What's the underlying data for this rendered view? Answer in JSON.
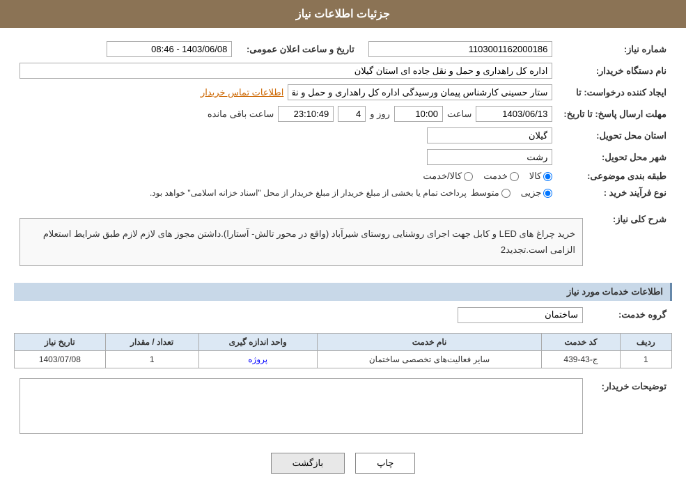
{
  "header": {
    "title": "جزئیات اطلاعات نیاز"
  },
  "fields": {
    "need_number_label": "شماره نیاز:",
    "need_number_value": "1103001162000186",
    "announce_date_label": "تاریخ و ساعت اعلان عمومی:",
    "announce_date_value": "1403/06/08 - 08:46",
    "buyer_name_label": "نام دستگاه خریدار:",
    "buyer_name_value": "اداره کل راهداری و حمل و نقل جاده ای استان گیلان",
    "creator_label": "ایجاد کننده درخواست: تا",
    "creator_value": "ستار حسینی کارشناس پیمان ورسیدگی اداره کل راهداری و حمل و نقل جاده اد",
    "creator_link": "اطلاعات تماس خریدار",
    "deadline_label": "مهلت ارسال پاسخ: تا تاریخ:",
    "deadline_date": "1403/06/13",
    "deadline_time_label": "ساعت",
    "deadline_time": "10:00",
    "deadline_days_label": "روز و",
    "deadline_days": "4",
    "deadline_remaining_label": "ساعت باقی مانده",
    "deadline_remaining": "23:10:49",
    "province_label": "استان محل تحویل:",
    "province_value": "گیلان",
    "city_label": "شهر محل تحویل:",
    "city_value": "رشت",
    "category_label": "طبقه بندی موضوعی:",
    "category_radio1": "کالا",
    "category_radio2": "خدمت",
    "category_radio3": "کالا/خدمت",
    "process_label": "نوع فرآیند خرید :",
    "process_radio1": "جزیی",
    "process_radio2": "متوسط",
    "process_note": "پرداخت تمام یا بخشی از مبلغ خریدار از مبلغ خریدار از محل \"اسناد خزانه اسلامی\" خواهد بود.",
    "description_label": "شرح کلی نیاز:",
    "description_text": "خرید چراغ های  LED  و کابل جهت اجرای روشنایی روستای شیرآباد (واقع در محور تالش- آستارا).داشتن مجوز های لازم لازم طبق شرایط استعلام الزامی است.تجدید2",
    "services_section": "اطلاعات خدمات مورد نیاز",
    "service_group_label": "گروه خدمت:",
    "service_group_value": "ساختمان",
    "table_headers": {
      "row_num": "ردیف",
      "service_code": "کد خدمت",
      "service_name": "نام خدمت",
      "unit": "واحد اندازه گیری",
      "quantity": "تعداد / مقدار",
      "date": "تاریخ نیاز"
    },
    "table_rows": [
      {
        "row_num": "1",
        "service_code": "ج-43-439",
        "service_name": "سایر فعالیت‌های تخصصی ساختمان",
        "unit": "پروژه",
        "quantity": "1",
        "date": "1403/07/08"
      }
    ],
    "buyer_desc_label": "توضیحات خریدار:",
    "buyer_desc_value": ""
  },
  "buttons": {
    "print": "چاپ",
    "back": "بازگشت"
  }
}
